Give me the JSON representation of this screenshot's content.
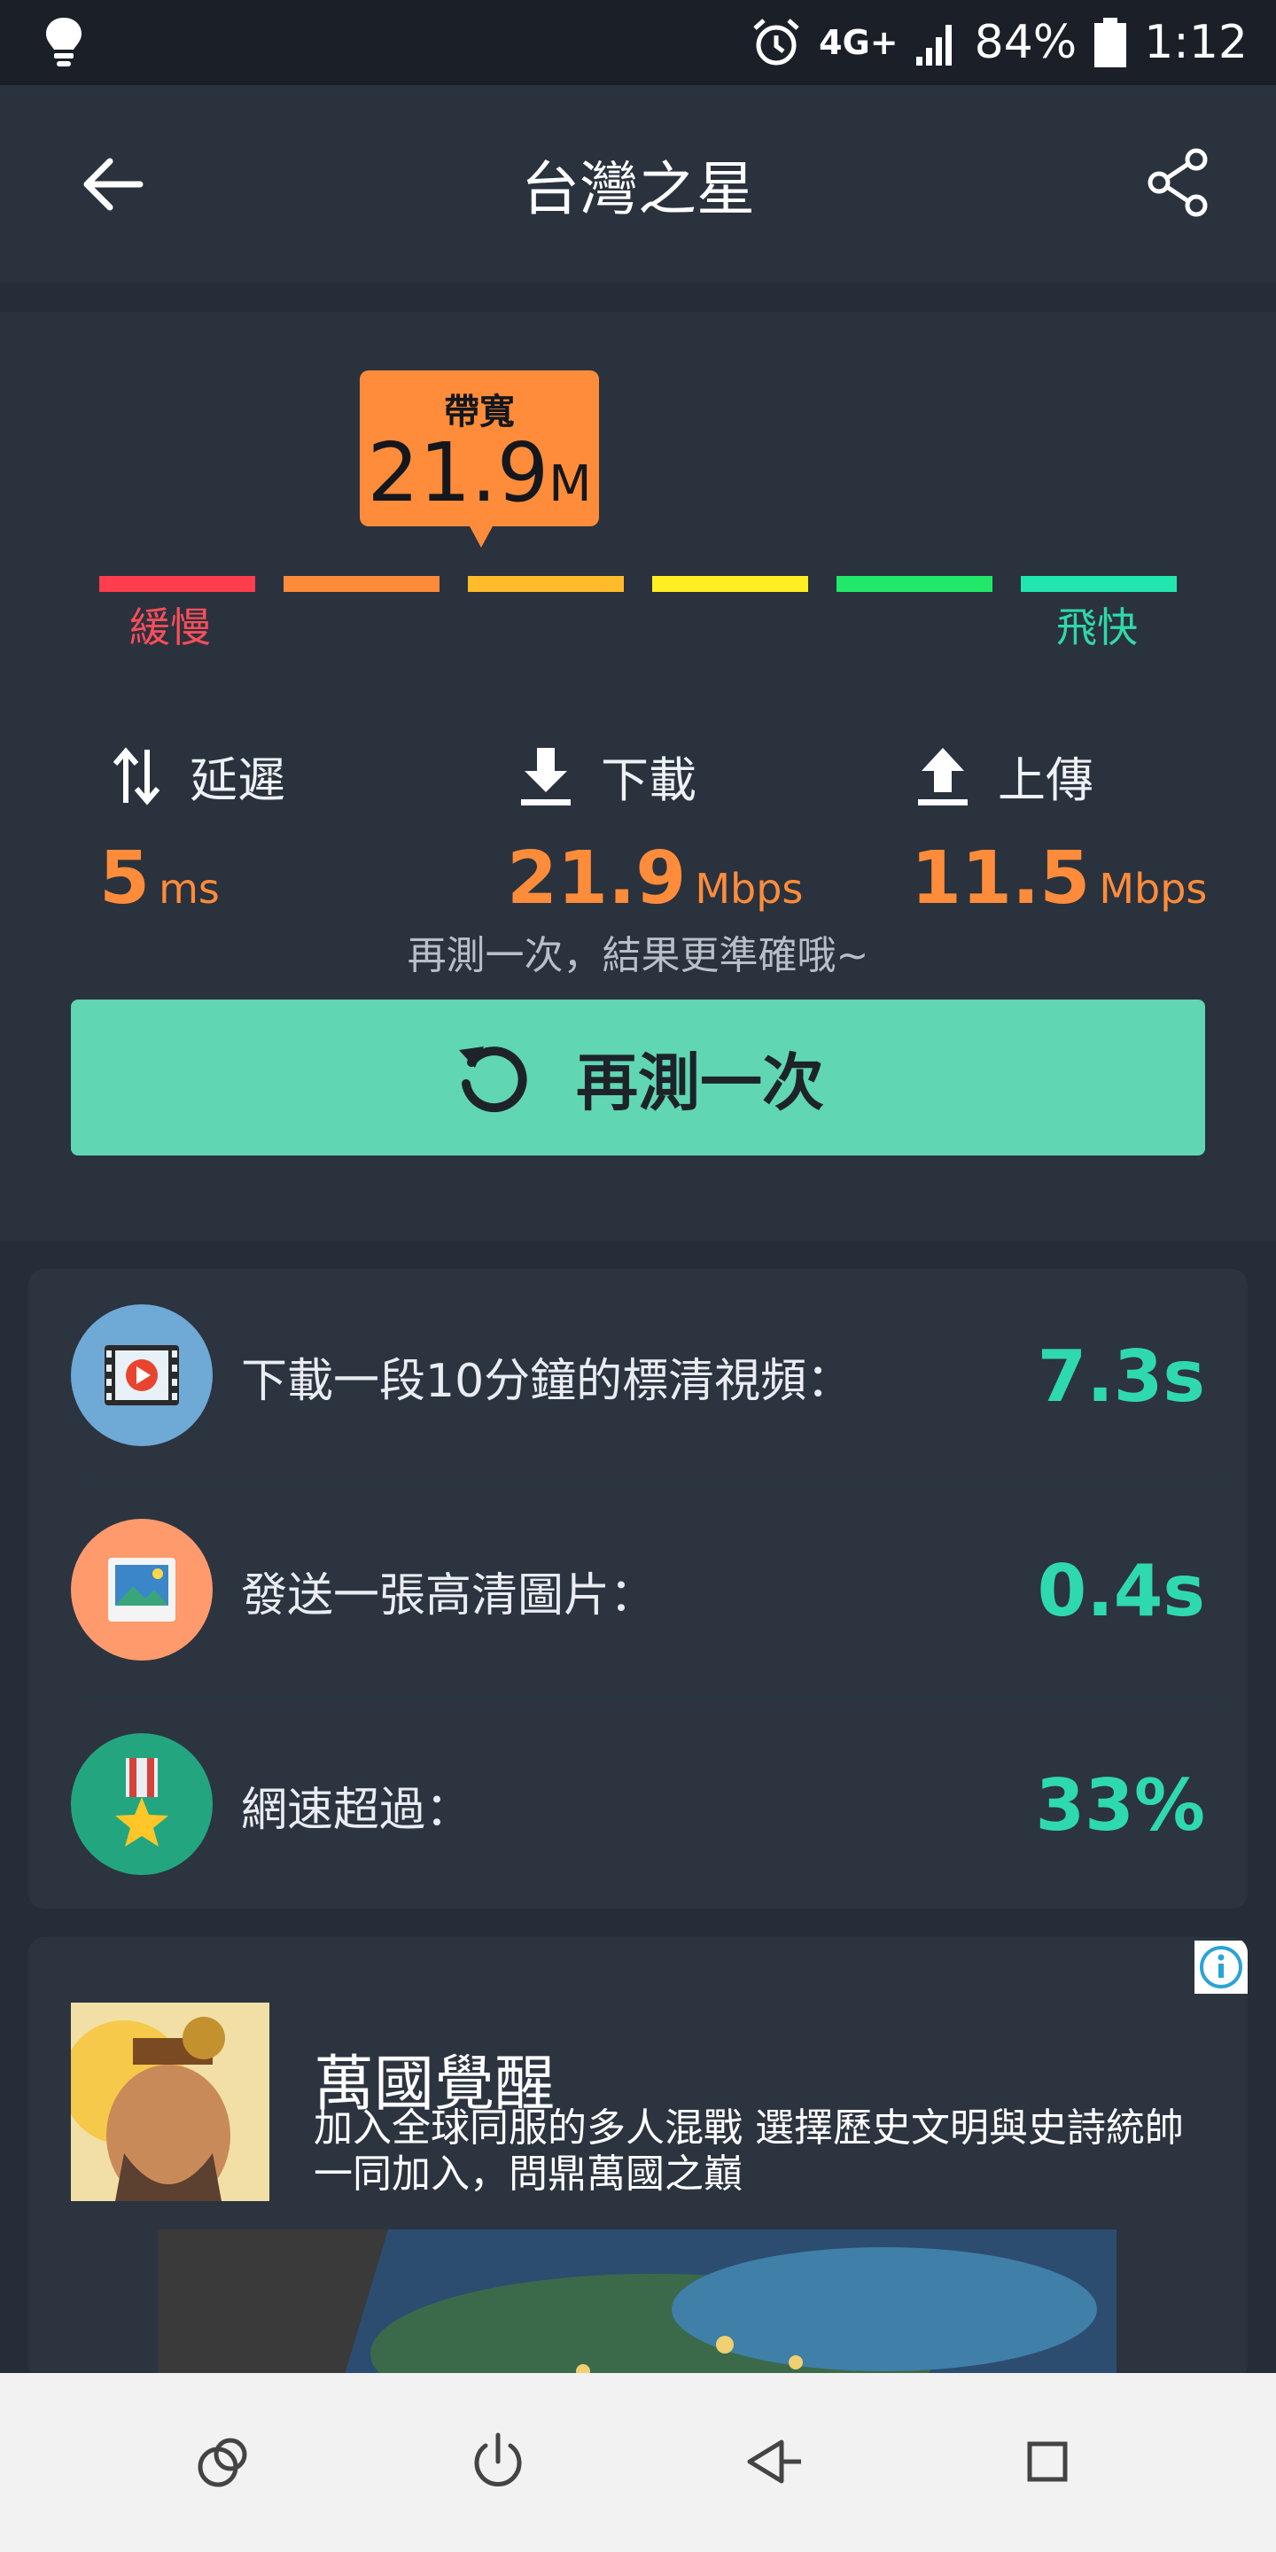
{
  "status_bar": {
    "network": "4G+",
    "battery": "84%",
    "time": "1:12",
    "icons": [
      "lightbulb-icon",
      "alarm-icon",
      "signal-icon",
      "battery-icon"
    ]
  },
  "app_bar": {
    "title": "台灣之星",
    "back_icon": "arrow-back-icon",
    "share_icon": "share-icon"
  },
  "speed_test": {
    "bandwidth_label": "帶寬",
    "bandwidth_value": "21.9",
    "bandwidth_unit": "M",
    "scale_colors": [
      "#ff3d4d",
      "#ff8a3a",
      "#ffbb2a",
      "#ffee22",
      "#22e86a",
      "#22e6b0"
    ],
    "bandwidth_level": 3,
    "slow_label": "緩慢",
    "fast_label": "飛快",
    "latency": {
      "label": "延遲",
      "value": "5",
      "unit": "ms"
    },
    "download": {
      "label": "下載",
      "value": "21.9",
      "unit": "Mbps"
    },
    "upload": {
      "label": "上傳",
      "value": "11.5",
      "unit": "Mbps"
    },
    "hint": "再測一次，結果更準確哦~",
    "retest_label": "再測一次"
  },
  "stats": [
    {
      "label": "下載一段10分鐘的標清視頻：",
      "value": "7.3s",
      "icon": "video-icon",
      "color": "#6fa9d6"
    },
    {
      "label": "發送一張高清圖片：",
      "value": "0.4s",
      "icon": "picture-icon",
      "color": "#ff9a6c"
    },
    {
      "label": "網速超過：",
      "value": "33%",
      "icon": "medal-icon",
      "color": "#23a680"
    }
  ],
  "ad": {
    "title": "萬國覺醒",
    "description": "加入全球同服的多人混戰 選擇歷史文明與史詩統帥 一同加入，問鼎萬國之巔",
    "info_icon": "info-icon"
  },
  "nav_bar": {
    "icons": [
      "assistant-icon",
      "power-icon",
      "back-icon",
      "recents-icon"
    ]
  }
}
